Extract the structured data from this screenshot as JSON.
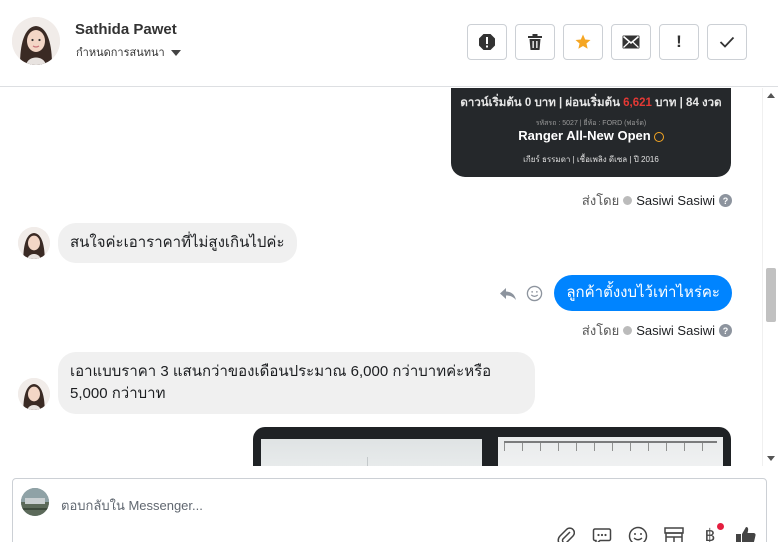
{
  "header": {
    "contact_name": "Sathida Pawet",
    "label_select": "กำหนดการสนทนา",
    "actions": [
      "spam-icon",
      "trash-icon",
      "star-icon",
      "envelope-icon",
      "exclamation-icon",
      "check-icon"
    ],
    "star_color": "#f5a623"
  },
  "messages": {
    "car_card": {
      "line1_prefix": "ดาวน์เริ่มต้น 0 บาท | ผ่อนเริ่มต้น ",
      "line1_price": "6,621",
      "line1_suffix": " บาท | 84 งวด",
      "line2": "รหัสรถ : 5027 | ยี่ห้อ : FORD (ฟอร์ด)",
      "model": "Ranger All-New Open",
      "line4": "เกียร์ ธรรมดา  |  เชื้อเพลิง ดีเซล  |  ปี 2016"
    },
    "sent_by_prefix": "ส่งโดย",
    "sent_by_name": "Sasiwi Sasiwi",
    "incoming_1": "สนใจค่ะเอาราคาที่ไม่สูงเกินไปค่ะ",
    "outgoing_1": "ลูกค้าตั้งงบไว้เท่าไหร่คะ",
    "incoming_2_line1": "เอาแบบราคา 3 แสนกว่าของเดือนประมาณ 6,000 กว่าบาทค่ะหรือ",
    "incoming_2_line2": "5,000 กว่าบาท",
    "outgoing_color": "#0084ff"
  },
  "composer": {
    "placeholder": "ตอบกลับใน Messenger...",
    "tools": [
      "paperclip-icon",
      "saved-reply-icon",
      "emoji-icon",
      "store-icon",
      "baht-icon",
      "thumbs-up-icon"
    ]
  }
}
